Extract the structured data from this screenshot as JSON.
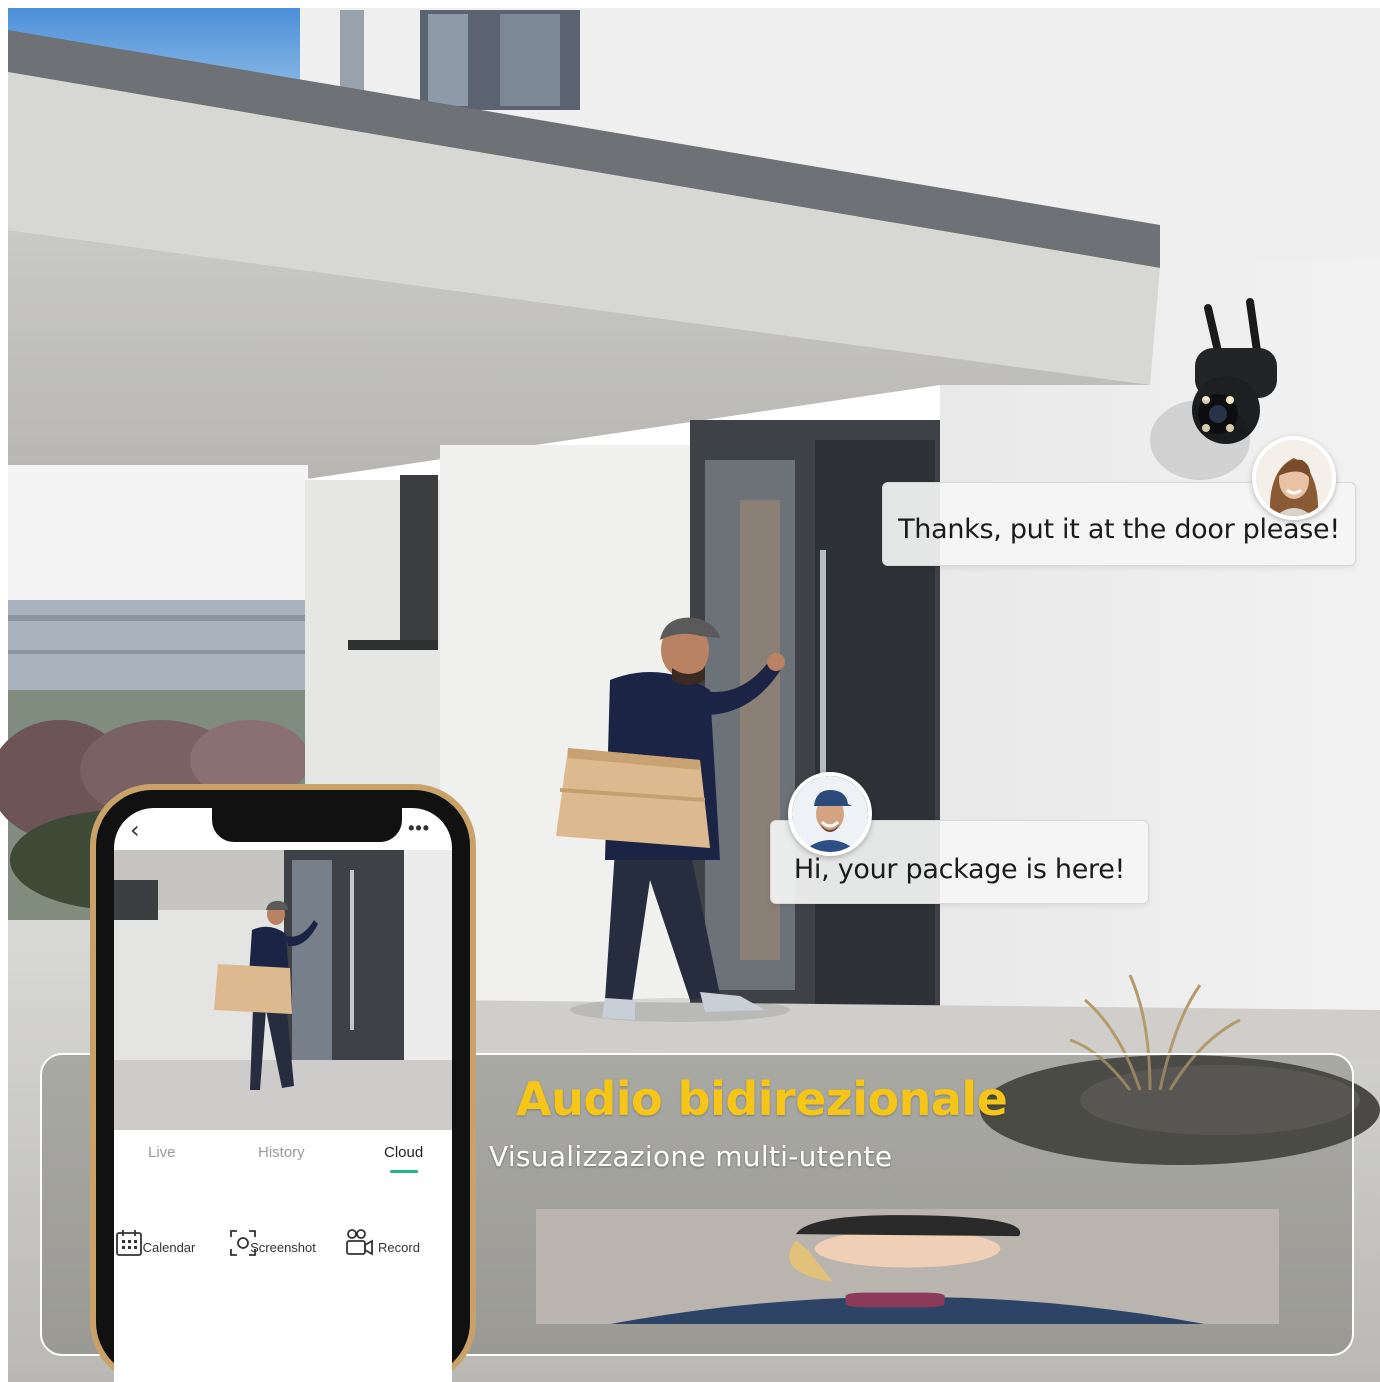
{
  "chat": {
    "owner_message": "Thanks, put it at the door please!",
    "courier_message": "Hi, your package is here!"
  },
  "banner": {
    "headline": "Audio bidirezionale",
    "subline": "Visualizzazione multi-utente",
    "headline_color": "#f5c518"
  },
  "phone_app": {
    "tabs": [
      "Live",
      "History",
      "Cloud"
    ],
    "active_tab": "Cloud",
    "tools": [
      "Calendar",
      "Screenshot",
      "Record"
    ],
    "accent_color": "#1fb58a",
    "icons": {
      "back": "chevron-left-icon",
      "more": "more-dots-icon",
      "calendar": "calendar-icon",
      "screenshot": "screenshot-icon",
      "record": "record-icon"
    }
  }
}
